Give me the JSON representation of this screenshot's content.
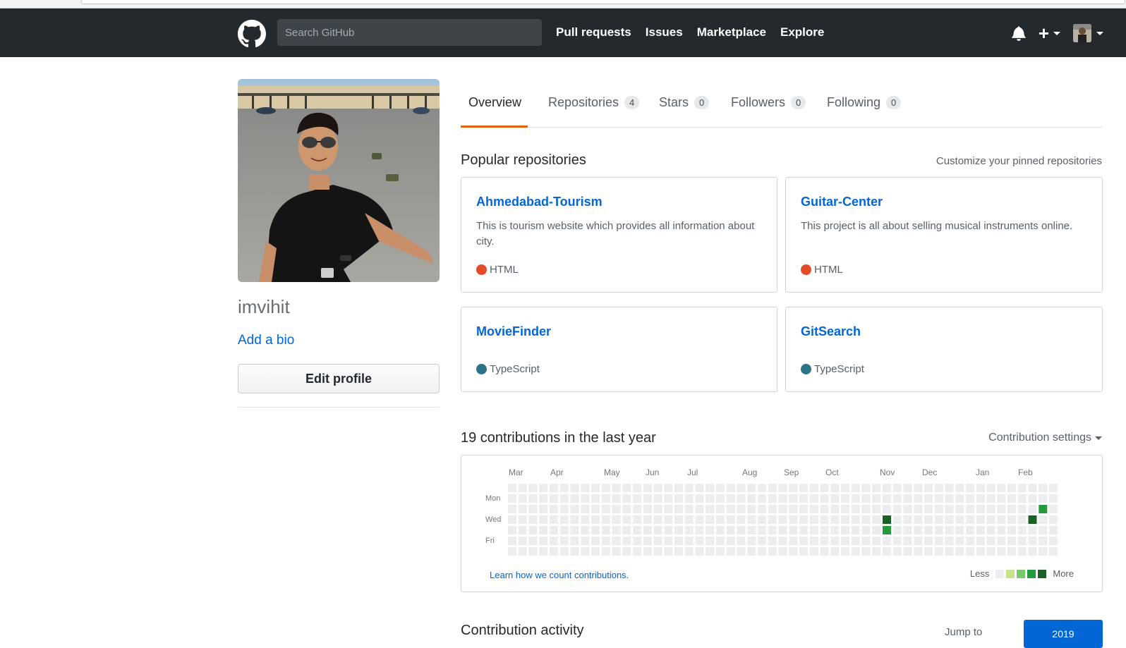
{
  "header": {
    "search_placeholder": "Search GitHub",
    "nav": [
      "Pull requests",
      "Issues",
      "Marketplace",
      "Explore"
    ],
    "plus_label": "+"
  },
  "profile": {
    "username": "imvihit",
    "add_bio": "Add a bio",
    "edit_profile": "Edit profile"
  },
  "tabs": [
    {
      "label": "Overview",
      "count": null
    },
    {
      "label": "Repositories",
      "count": "4"
    },
    {
      "label": "Stars",
      "count": "0"
    },
    {
      "label": "Followers",
      "count": "0"
    },
    {
      "label": "Following",
      "count": "0"
    }
  ],
  "popular": {
    "title": "Popular repositories",
    "customize": "Customize your pinned repositories",
    "repos": [
      {
        "name": "Ahmedabad-Tourism",
        "description": "This is tourism website which provides all information about city.",
        "language": "HTML",
        "lang_color": "#e34c26"
      },
      {
        "name": "Guitar-Center",
        "description": "This project is all about selling musical instruments online.",
        "language": "HTML",
        "lang_color": "#e34c26"
      },
      {
        "name": "MovieFinder",
        "description": "",
        "language": "TypeScript",
        "lang_color": "#2b7489"
      },
      {
        "name": "GitSearch",
        "description": "",
        "language": "TypeScript",
        "lang_color": "#2b7489"
      }
    ]
  },
  "contributions": {
    "title": "19 contributions in the last year",
    "settings": "Contribution settings",
    "months": [
      "Mar",
      "Apr",
      "May",
      "Jun",
      "Jul",
      "Aug",
      "Sep",
      "Oct",
      "Nov",
      "Dec",
      "Jan",
      "Feb"
    ],
    "weekdays": [
      "Mon",
      "Wed",
      "Fri"
    ],
    "learn_link": "Learn how we count contributions.",
    "legend_less": "Less",
    "legend_more": "More",
    "colors": [
      "#ebedf0",
      "#c6e48b",
      "#7bc96f",
      "#239a3b",
      "#196127"
    ],
    "active_cells": [
      {
        "week": 36,
        "day": 3,
        "level": 4
      },
      {
        "week": 36,
        "day": 4,
        "level": 3
      },
      {
        "week": 50,
        "day": 3,
        "level": 4
      },
      {
        "week": 51,
        "day": 2,
        "level": 3
      }
    ]
  },
  "activity": {
    "title": "Contribution activity",
    "jump_to": "Jump to",
    "year": "2019"
  }
}
